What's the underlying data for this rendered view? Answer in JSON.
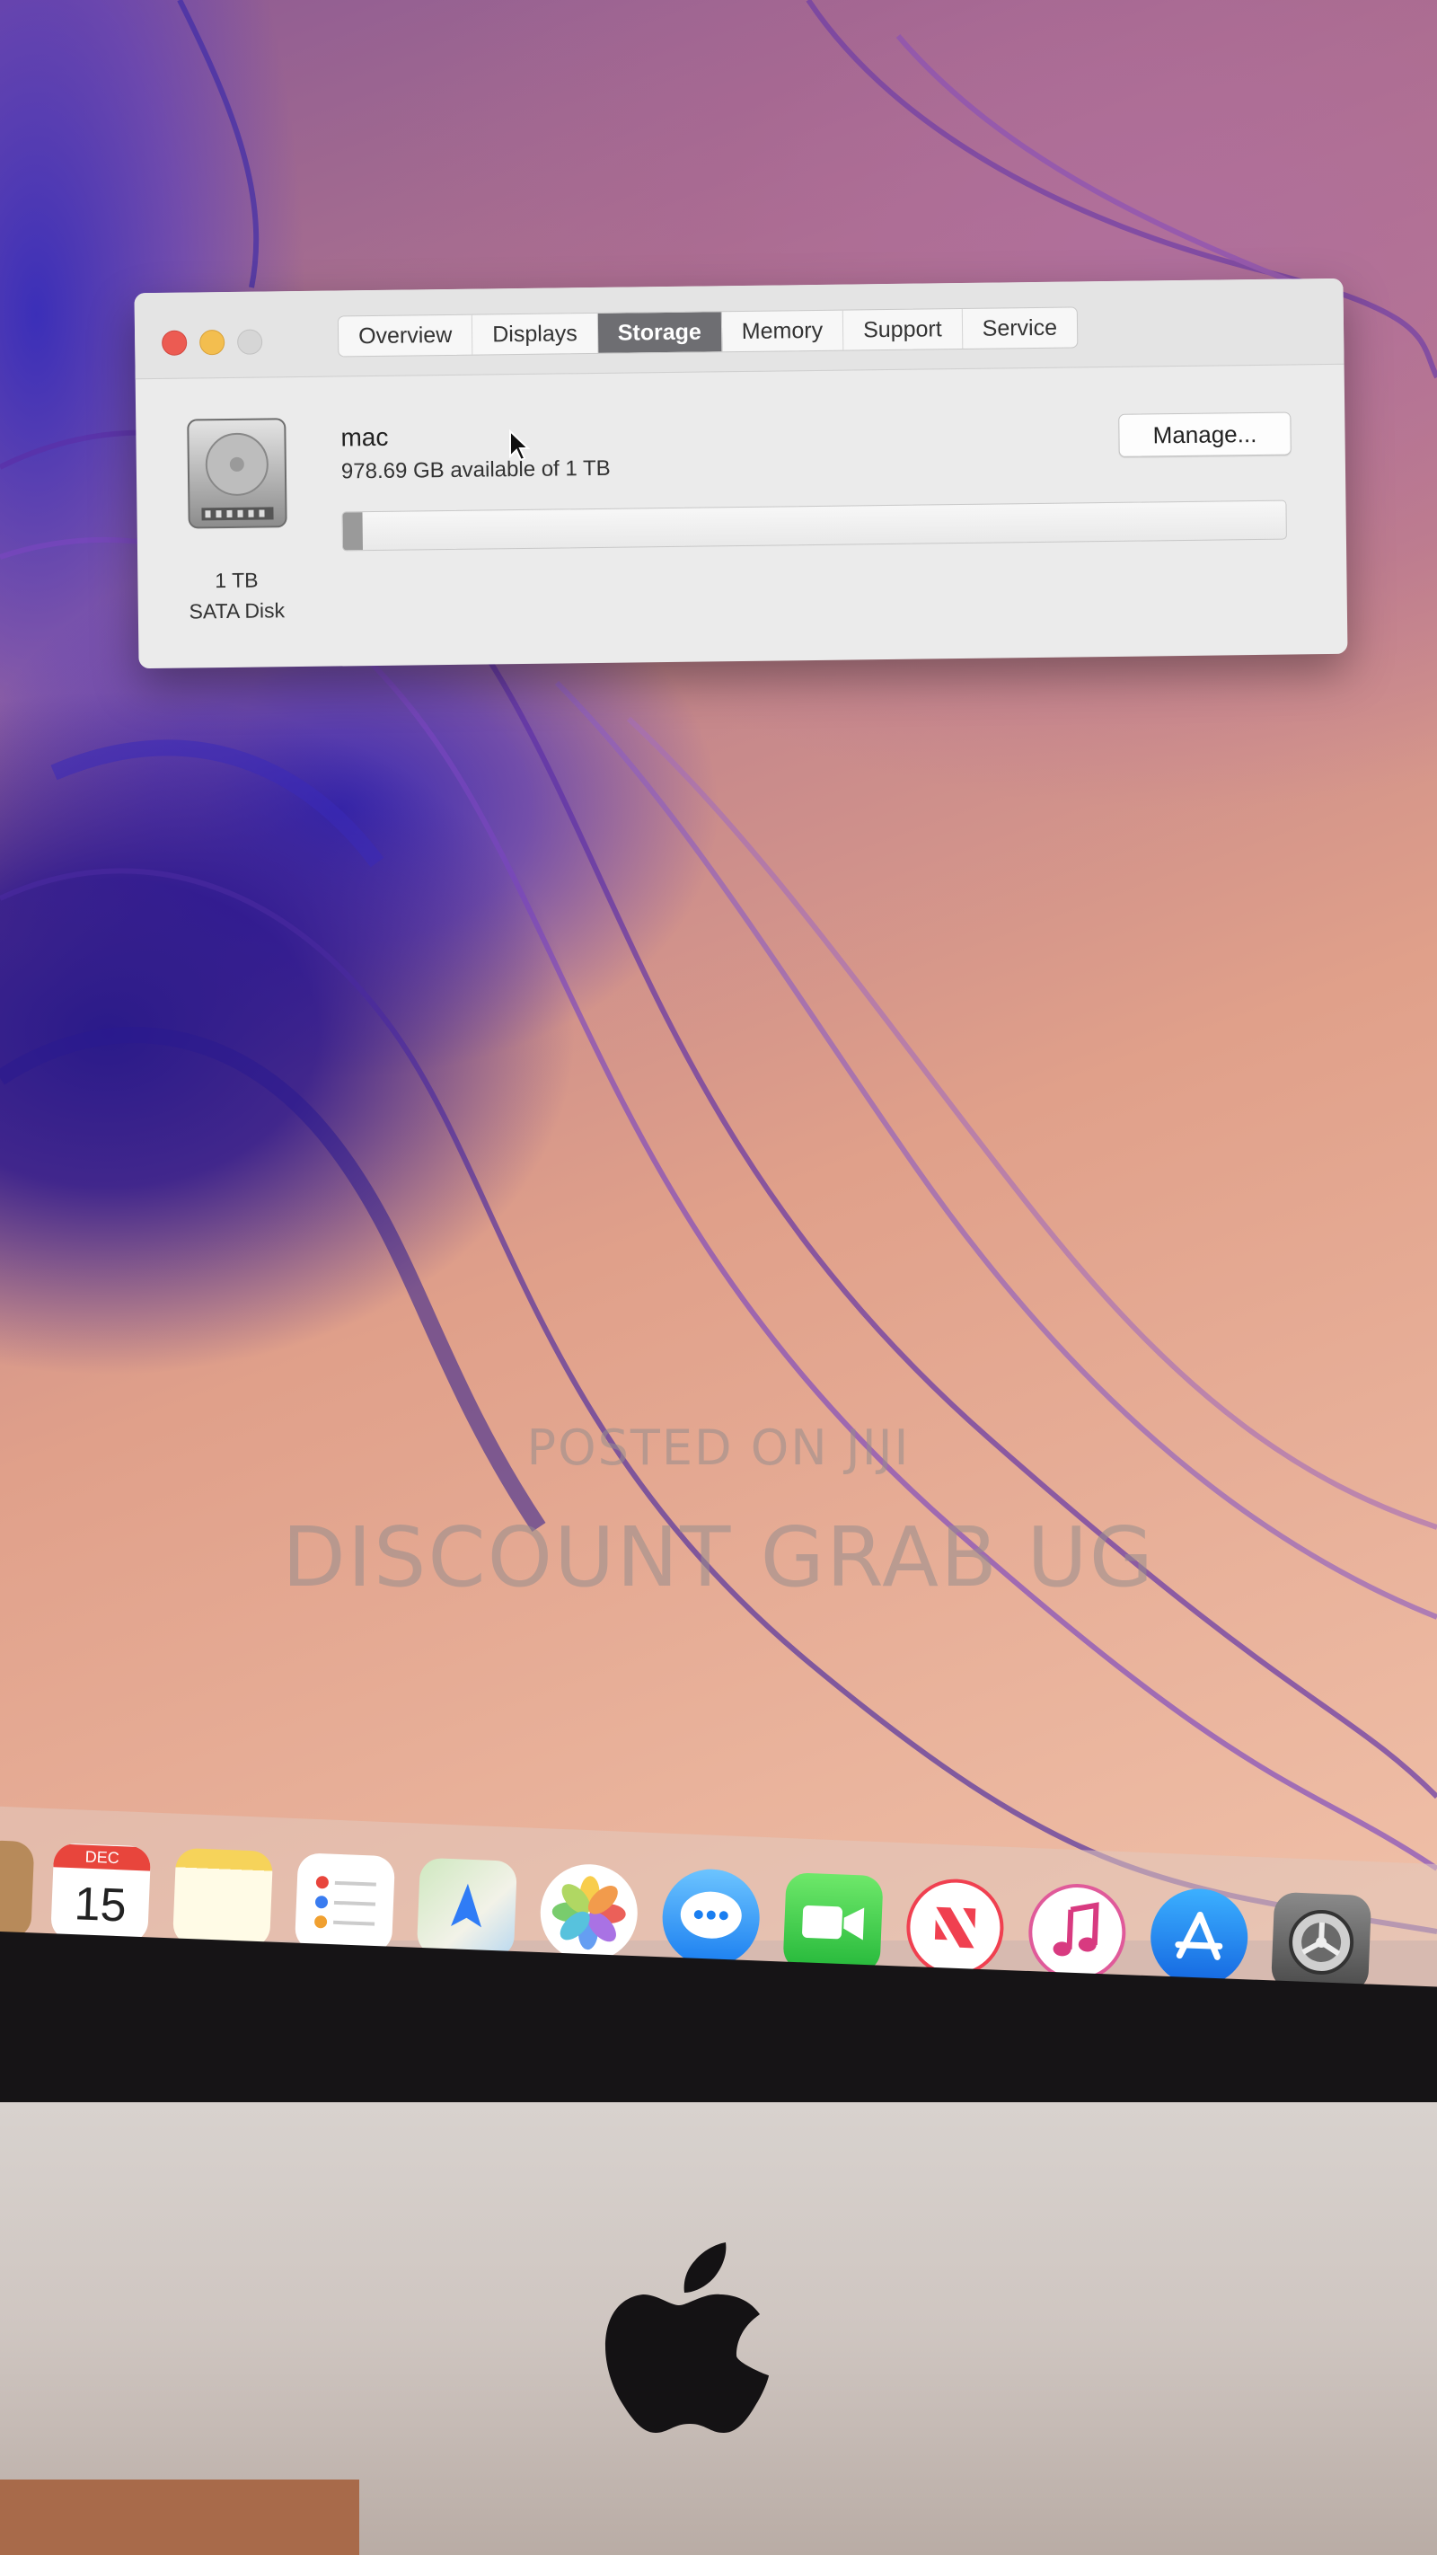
{
  "window": {
    "tabs": [
      {
        "label": "Overview",
        "active": false
      },
      {
        "label": "Displays",
        "active": false
      },
      {
        "label": "Storage",
        "active": true
      },
      {
        "label": "Memory",
        "active": false
      },
      {
        "label": "Support",
        "active": false
      },
      {
        "label": "Service",
        "active": false
      }
    ],
    "disk": {
      "size": "1 TB",
      "type": "SATA Disk",
      "icon": "hard-drive-icon"
    },
    "volume": {
      "name": "mac",
      "available_text": "978.69 GB available of 1 TB",
      "used_fraction": 0.021
    },
    "manage_label": "Manage..."
  },
  "dock": {
    "calendar": {
      "month": "DEC",
      "day": "15"
    },
    "icons": [
      "notes-icon",
      "reminders-icon",
      "maps-icon",
      "photos-icon",
      "messages-icon",
      "facetime-icon",
      "news-icon",
      "music-icon",
      "app-store-icon",
      "system-preferences-icon"
    ]
  },
  "watermark": {
    "line1": "POSTED ON JIJI",
    "line2": "DISCOUNT GRAB UG"
  },
  "colors": {
    "close": "#ec5b52",
    "minimize": "#f3be4f",
    "active_tab": "#6e6e72"
  }
}
